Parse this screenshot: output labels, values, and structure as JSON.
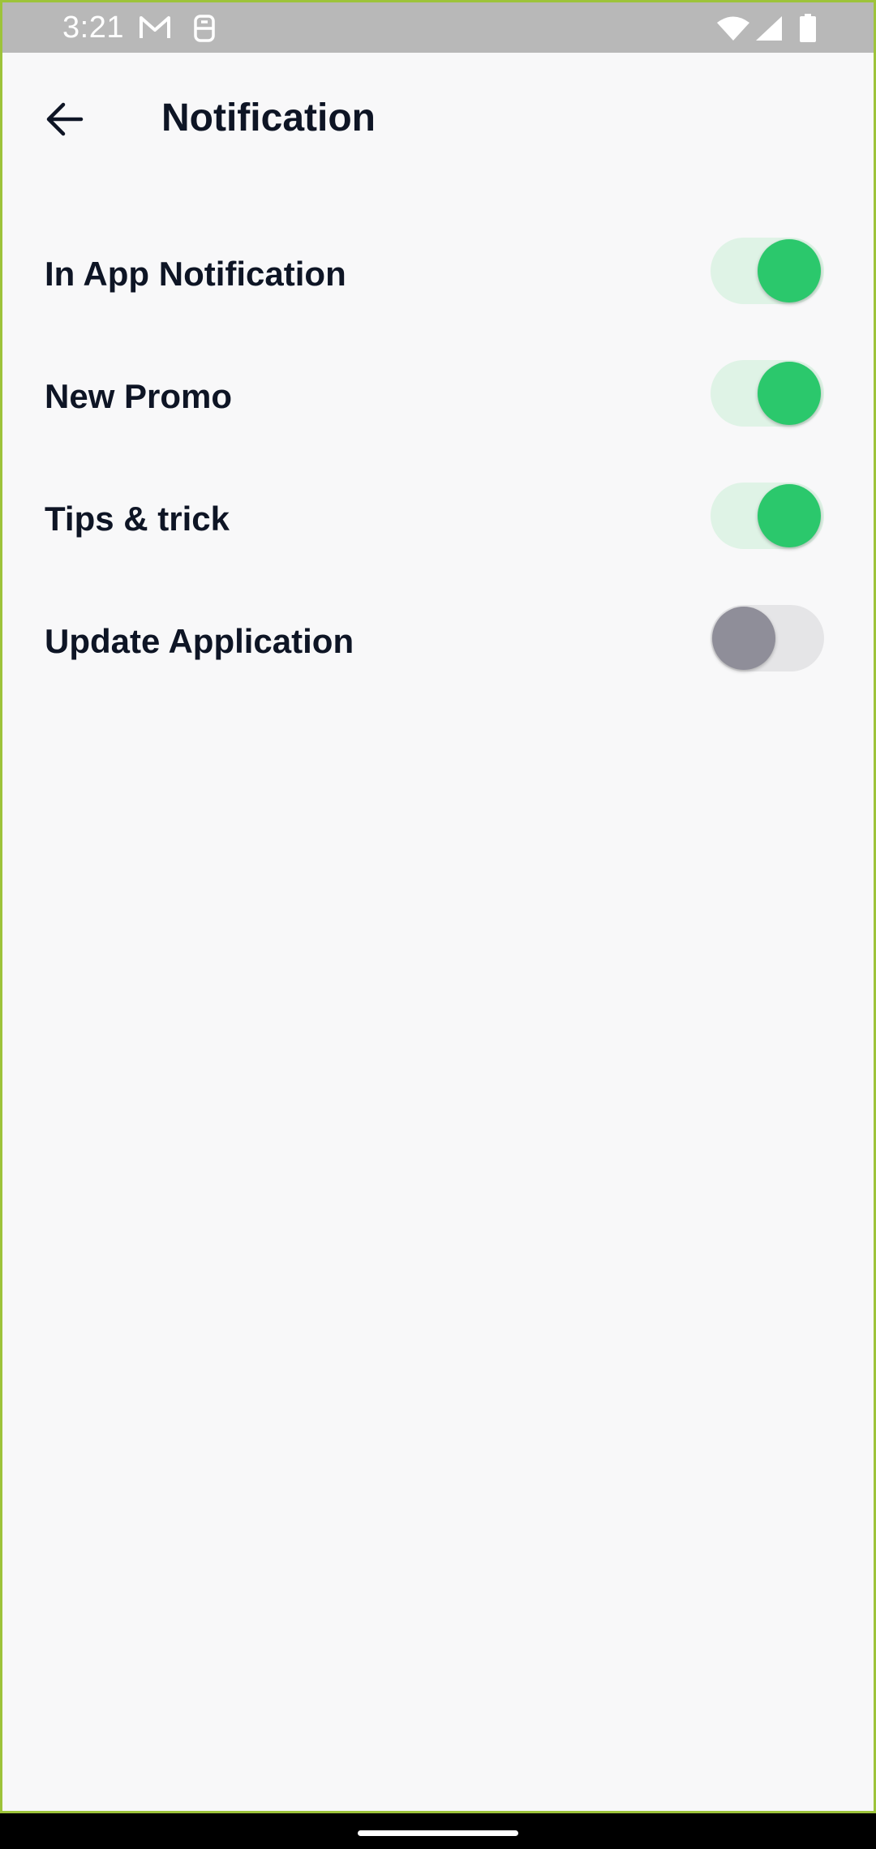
{
  "status_bar": {
    "time": "3:21",
    "icons": [
      "gmail-icon",
      "sim-icon",
      "wifi-icon",
      "signal-icon",
      "battery-icon"
    ]
  },
  "header": {
    "back_icon": "arrow-left-icon",
    "title": "Notification"
  },
  "settings": [
    {
      "label": "In App Notification",
      "enabled": true
    },
    {
      "label": "New Promo",
      "enabled": true
    },
    {
      "label": "Tips & trick",
      "enabled": true
    },
    {
      "label": "Update Application",
      "enabled": false
    }
  ],
  "colors": {
    "toggle_on": "#2bc86c",
    "toggle_on_track": "#dff3e6",
    "toggle_off": "#8f8e99",
    "toggle_off_track": "#e5e5e7",
    "text": "#0e1525",
    "background": "#f8f8f9"
  }
}
